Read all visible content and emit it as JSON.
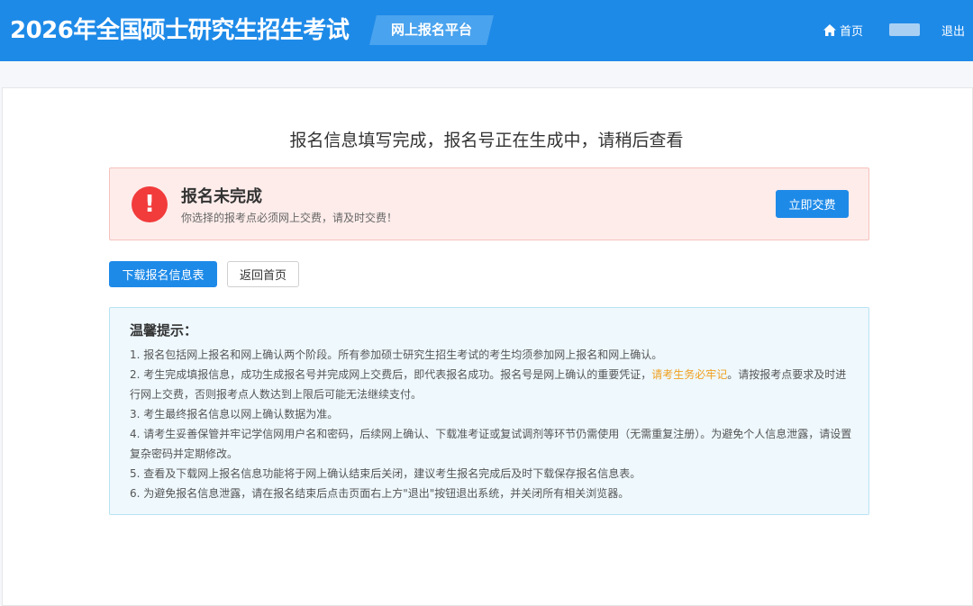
{
  "header": {
    "title": "2026年全国硕士研究生招生考试",
    "platform_tag": "网上报名平台",
    "home_label": "首页",
    "logout_label": "退出"
  },
  "main": {
    "headline": "报名信息填写完成，报名号正在生成中，请稍后查看",
    "alert": {
      "icon": "!",
      "title": "报名未完成",
      "desc": "你选择的报考点必须网上交费，请及时交费！",
      "pay_button": "立即交费"
    },
    "actions": {
      "download_label": "下载报名信息表",
      "back_label": "返回首页"
    },
    "tips": {
      "title": "温馨提示：",
      "items": [
        "1. 报名包括网上报名和网上确认两个阶段。所有参加硕士研究生招生考试的考生均须参加网上报名和网上确认。",
        "2. 考生完成填报信息，成功生成报名号并完成网上交费后，即代表报名成功。报名号是网上确认的重要凭证，",
        "请考生务必牢记",
        "。请按报考点要求及时进行网上交费，否则报考点人数达到上限后可能无法继续支付。",
        "3. 考生最终报名信息以网上确认数据为准。",
        "4. 请考生妥善保管并牢记学信网用户名和密码，后续网上确认、下载准考证或复试调剂等环节仍需使用（无需重复注册）。为避免个人信息泄露，请设置复杂密码并定期修改。",
        "5. 查看及下载网上报名信息功能将于网上确认结束后关闭，建议考生报名完成后及时下载保存报名信息表。",
        "6. 为避免报名信息泄露，请在报名结束后点击页面右上方\"退出\"按钮退出系统，并关闭所有相关浏览器。"
      ]
    }
  },
  "colors": {
    "header_bg": "#1e8ae8",
    "alert_bg": "#fdecea",
    "alert_icon": "#f23b3b",
    "tips_bg": "#eef8fd",
    "highlight": "#f0a020"
  }
}
